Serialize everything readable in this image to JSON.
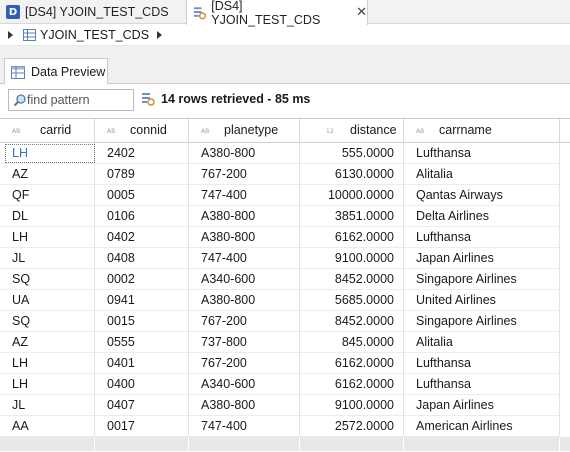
{
  "editor_tabs": [
    {
      "label": "[DS4] YJOIN_TEST_CDS",
      "icon": "ds-icon"
    },
    {
      "label": "[DS4] YJOIN_TEST_CDS",
      "icon": "query-icon",
      "close": "✕"
    }
  ],
  "breadcrumb": {
    "item": "YJOIN_TEST_CDS"
  },
  "view_tab": {
    "label": "Data Preview"
  },
  "search": {
    "placeholder": "find pattern"
  },
  "status": {
    "text": "14 rows retrieved - 85 ms"
  },
  "columns": [
    {
      "name": "carrid",
      "type": "AB"
    },
    {
      "name": "connid",
      "type": "AB"
    },
    {
      "name": "planetype",
      "type": "AB"
    },
    {
      "name": "distance",
      "type": "12"
    },
    {
      "name": "carrname",
      "type": "AB"
    }
  ],
  "rows": [
    [
      "LH",
      "2402",
      "A380-800",
      "555.0000",
      "Lufthansa"
    ],
    [
      "AZ",
      "0789",
      "767-200",
      "6130.0000",
      "Alitalia"
    ],
    [
      "QF",
      "0005",
      "747-400",
      "10000.0000",
      "Qantas Airways"
    ],
    [
      "DL",
      "0106",
      "A380-800",
      "3851.0000",
      "Delta Airlines"
    ],
    [
      "LH",
      "0402",
      "A380-800",
      "6162.0000",
      "Lufthansa"
    ],
    [
      "JL",
      "0408",
      "747-400",
      "9100.0000",
      "Japan Airlines"
    ],
    [
      "SQ",
      "0002",
      "A340-600",
      "8452.0000",
      "Singapore Airlines"
    ],
    [
      "UA",
      "0941",
      "A380-800",
      "5685.0000",
      "United Airlines"
    ],
    [
      "SQ",
      "0015",
      "767-200",
      "8452.0000",
      "Singapore Airlines"
    ],
    [
      "AZ",
      "0555",
      "737-800",
      "845.0000",
      "Alitalia"
    ],
    [
      "LH",
      "0401",
      "767-200",
      "6162.0000",
      "Lufthansa"
    ],
    [
      "LH",
      "0400",
      "A340-600",
      "6162.0000",
      "Lufthansa"
    ],
    [
      "JL",
      "0407",
      "A380-800",
      "9100.0000",
      "Japan Airlines"
    ],
    [
      "AA",
      "0017",
      "747-400",
      "2572.0000",
      "American Airlines"
    ]
  ],
  "colors": {
    "accent": "#2f5fb3",
    "selected_text": "#3a6fc4"
  }
}
